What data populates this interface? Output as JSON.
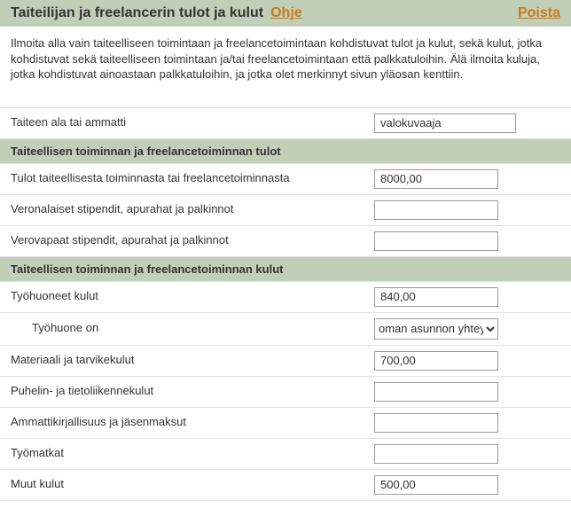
{
  "header": {
    "title": "Taiteilijan ja freelancerin tulot ja kulut",
    "help_label": "Ohje",
    "remove_label": "Poista"
  },
  "intro": "Ilmoita alla vain taiteelliseen toimintaan ja freelancetoimintaan kohdistuvat tulot ja kulut, sekä kulut, jotka kohdistuvat sekä taiteelliseen toimintaan ja/tai freelancetoimintaan että palkkatuloihin. Älä ilmoita kuluja, jotka kohdistuvat ainoastaan palkkatuloihin, ja jotka olet merkinnyt sivun yläosan kenttiin.",
  "fields": {
    "profession": {
      "label": "Taiteen ala tai ammatti",
      "value": "valokuvaaja"
    }
  },
  "sections": {
    "income": {
      "title": "Taiteellisen toiminnan ja freelancetoiminnan tulot",
      "rows": {
        "art_income": {
          "label": "Tulot taiteellisesta toiminnasta tai freelancetoiminnasta",
          "value": "8000,00"
        },
        "taxable_grants": {
          "label": "Veronalaiset stipendit, apurahat ja palkinnot",
          "value": ""
        },
        "taxfree_grants": {
          "label": "Verovapaat stipendit, apurahat ja palkinnot",
          "value": ""
        }
      }
    },
    "expenses": {
      "title": "Taiteellisen toiminnan ja freelancetoiminnan kulut",
      "rows": {
        "workspace": {
          "label": "Työhuoneet kulut",
          "value": "840,00"
        },
        "workspace_type": {
          "label": "Työhuone on",
          "selected": "oman asunnon yhteydessä"
        },
        "materials": {
          "label": "Materiaali ja tarvikekulut",
          "value": "700,00"
        },
        "telecom": {
          "label": "Puhelin- ja tietoliikennekulut",
          "value": ""
        },
        "literature": {
          "label": "Ammattikirjallisuus ja jäsenmaksut",
          "value": ""
        },
        "travel": {
          "label": "Työmatkat",
          "value": ""
        },
        "other": {
          "label": "Muut kulut",
          "value": "500,00"
        }
      }
    }
  }
}
